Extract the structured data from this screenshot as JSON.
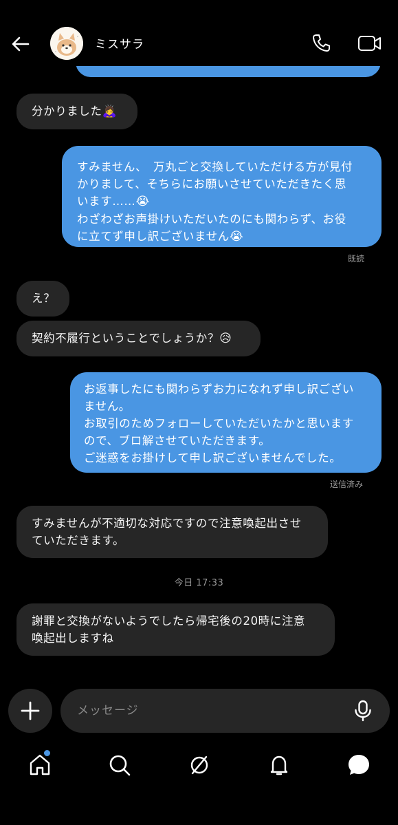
{
  "header": {
    "contact_name": "ミスサラ"
  },
  "messages": [
    {
      "text": "分かりました",
      "emoji": "🙇‍♀️"
    },
    {
      "lines": [
        "すみません、　万丸ごと交換していただける方が見付",
        "かりまして、そちらにお願いさせていただきたく思",
        "います……",
        "わざわざお声掛けいただいたのにも関わらず、お役",
        "に立てず申し訳ございません"
      ],
      "emoji": "😭"
    },
    {
      "status": "既読"
    },
    {
      "text": "え？"
    },
    {
      "text": "契約不履行ということでしょうか？",
      "emoji": "😥"
    },
    {
      "lines": [
        "お返事したにも関わらずお力になれず申し訳ござい",
        "ません。",
        "お取引のためフォローしていただいたかと思います",
        "ので、ブロ解させていただきます。",
        "ご迷惑をお掛けして申し訳ございませんでした。"
      ]
    },
    {
      "status": "送信済み"
    },
    {
      "lines": [
        "すみませんが不適切な対応ですので注意喚起出させ",
        "ていただきます。"
      ]
    },
    {
      "time_divider": "今日 17:33"
    },
    {
      "lines": [
        "謝罪と交換がないようでしたら帰宅後の20時に注意",
        "喚起出しますね"
      ]
    }
  ],
  "composer": {
    "placeholder": "メッセージ"
  },
  "colors": {
    "outgoing": "#4a96e3",
    "incoming": "#262626",
    "background": "#000000"
  },
  "icons": [
    "back-arrow-icon",
    "phone-icon",
    "video-icon",
    "plus-icon",
    "microphone-icon",
    "home-icon",
    "search-icon",
    "explore-icon",
    "bell-icon",
    "messages-icon"
  ]
}
